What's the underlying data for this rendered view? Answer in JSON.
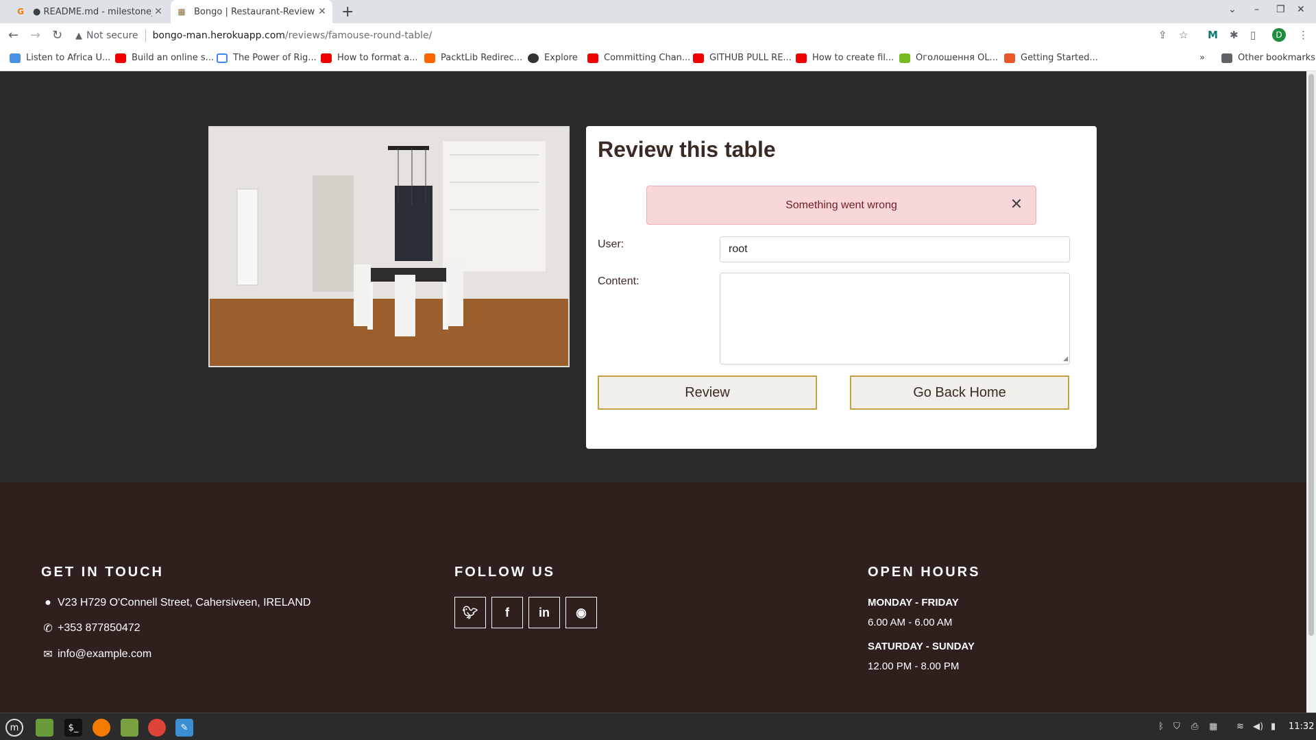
{
  "browser": {
    "tabs": [
      {
        "title": "● README.md - milestone_pr",
        "active": false
      },
      {
        "title": "Bongo | Restaurant-Review",
        "active": true
      }
    ],
    "address": {
      "security": "Not secure",
      "host": "bongo-man.herokuapp.com",
      "path": "/reviews/famouse-round-table/"
    },
    "profile_initial": "D",
    "bookmarks": [
      "Listen to Africa U...",
      "Build an online s...",
      "The Power of Rig...",
      "How to format a...",
      "PacktLib Redirec...",
      "Explore",
      "Committing Chan...",
      "GITHUB PULL RE...",
      "How to create fil...",
      "Оголошення OL...",
      "Getting Started..."
    ],
    "other_bookmarks": "Other bookmarks"
  },
  "review": {
    "heading": "Review this table",
    "alert": "Something went wrong",
    "user_label": "User:",
    "user_value": "root",
    "content_label": "Content:",
    "review_button": "Review",
    "home_button": "Go Back Home"
  },
  "footer": {
    "contact_heading": "GET IN TOUCH",
    "address": "V23 H729 O'Connell Street, Cahersiveen, IRELAND",
    "phone": "+353 877850472",
    "email": "info@example.com",
    "follow_heading": "FOLLOW US",
    "social": [
      "twitter-icon",
      "facebook-icon",
      "linkedin-icon",
      "github-icon"
    ],
    "hours_heading": "OPEN HOURS",
    "weekday_label": "MONDAY - FRIDAY",
    "weekday_hours": "6.00 AM - 6.00 AM",
    "weekend_label": "SATURDAY - SUNDAY",
    "weekend_hours": "12.00 PM - 8.00 PM"
  },
  "taskbar": {
    "clock": "11:32"
  },
  "colors": {
    "page_bg": "#2a2a2c",
    "footer_bg": "#2f201e",
    "accent": "#c8a246",
    "alert_bg": "#f8d7da"
  }
}
